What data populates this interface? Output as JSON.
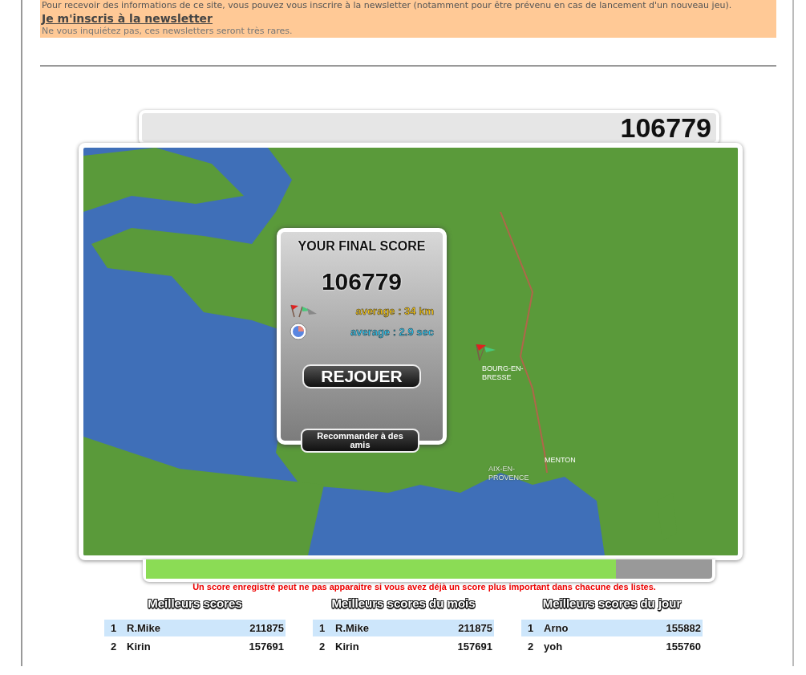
{
  "newsletter": {
    "intro": "Pour recevoir des informations de ce site, vous pouvez vous inscrire à la newsletter (notamment pour être prévenu en cas de lancement d'un nouveau jeu).",
    "link": "Je m'inscris à la newsletter",
    "note": "Ne vous inquiétez pas, ces newsletters seront très rares."
  },
  "game": {
    "score": "106779",
    "time_bar": {
      "level": 0.83
    },
    "map_labels": [
      {
        "text": "BOURG-EN-BRESSE",
        "kind": "city"
      },
      {
        "text": "MENTON",
        "kind": "city"
      },
      {
        "text": "AIX-EN-PROVENCE",
        "kind": "faded"
      }
    ],
    "final": {
      "title": "YOUR FINAL SCORE",
      "score": "106779",
      "distance": "average : 34 km",
      "time": "average : 2.9 sec",
      "replay": "REJOUER",
      "recommend": "Recommander à des amis"
    }
  },
  "notice": "Un score enregistré peut ne pas apparaitre si vous avez déjà un score plus important dans chacune des listes.",
  "leaderboards": [
    {
      "title": "Meilleurs scores",
      "rows": [
        {
          "rank": "1",
          "name": "R.Mike",
          "score": "211875"
        },
        {
          "rank": "2",
          "name": "Kirin",
          "score": "157691"
        }
      ]
    },
    {
      "title": "Meilleurs scores du mois",
      "rows": [
        {
          "rank": "1",
          "name": "R.Mike",
          "score": "211875"
        },
        {
          "rank": "2",
          "name": "Kirin",
          "score": "157691"
        }
      ]
    },
    {
      "title": "Meilleurs scores du jour",
      "rows": [
        {
          "rank": "1",
          "name": "Arno",
          "score": "155882"
        },
        {
          "rank": "2",
          "name": "yoh",
          "score": "155760"
        }
      ]
    }
  ]
}
